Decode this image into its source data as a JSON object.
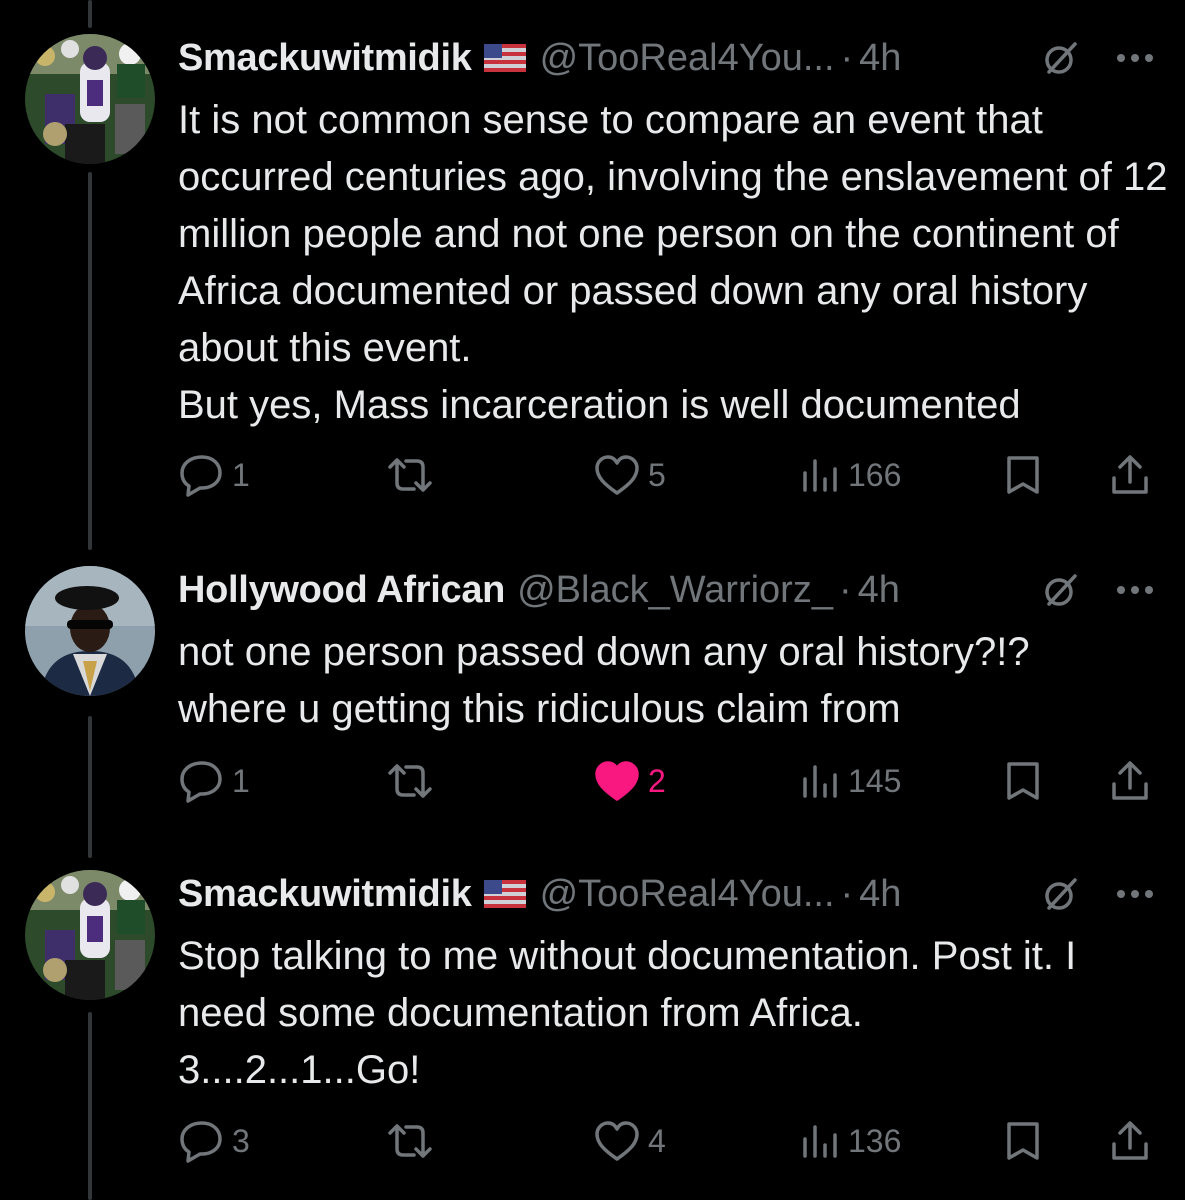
{
  "tweets": [
    {
      "display_name": "Smackuwitmidik",
      "has_flag": true,
      "handle": "@TooReal4You...",
      "separator": "·",
      "time": "4h",
      "text": "It is not common sense to compare an event that occurred centuries ago, involving the enslavement of 12 million people and not one person on the continent of Africa documented or passed down any oral history about this event.\nBut yes, Mass incarceration is well documented",
      "replies": "1",
      "reposts": "",
      "likes": "5",
      "liked": false,
      "views": "166",
      "avatar_icon": "sports-team-avatar"
    },
    {
      "display_name": "Hollywood African",
      "has_flag": false,
      "handle": "@Black_Warriorz_",
      "separator": "·",
      "time": "4h",
      "text": "not one person passed down any oral history?!?\nwhere u getting this ridiculous claim from",
      "replies": "1",
      "reposts": "",
      "likes": "2",
      "liked": true,
      "views": "145",
      "avatar_icon": "man-in-beret-avatar"
    },
    {
      "display_name": "Smackuwitmidik",
      "has_flag": true,
      "handle": "@TooReal4You...",
      "separator": "·",
      "time": "4h",
      "text": "Stop talking to me without documentation. Post it. I need some documentation from Africa.\n3....2...1...Go!",
      "replies": "3",
      "reposts": "",
      "likes": "4",
      "liked": false,
      "views": "136",
      "avatar_icon": "sports-team-avatar"
    }
  ],
  "icons": {
    "reply": "reply-icon",
    "repost": "repost-icon",
    "like": "heart-icon",
    "views": "views-icon",
    "bookmark": "bookmark-icon",
    "share": "share-icon",
    "grok": "slash-circle-icon",
    "more": "more-icon",
    "flag": "us-flag-icon"
  },
  "colors": {
    "background": "#000000",
    "text": "#e7e9ea",
    "muted": "#71767b",
    "like_active": "#f91880",
    "thread_line": "#333639"
  }
}
